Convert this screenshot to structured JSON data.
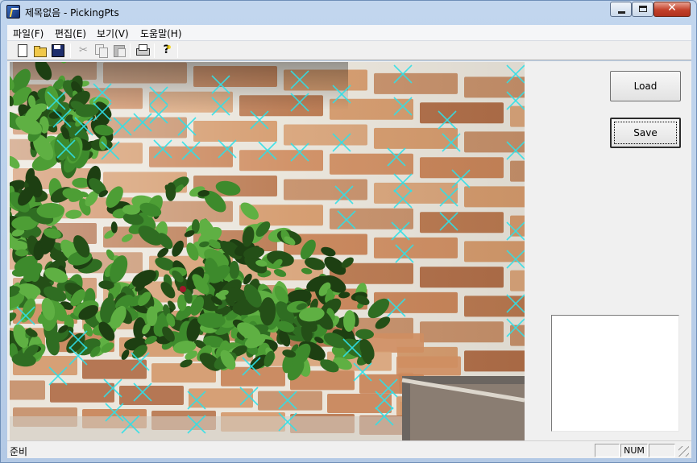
{
  "window": {
    "title": "제목없음 - PickingPts",
    "background_title_ghost": "(offscreen window title blurred)",
    "min_glyph": "",
    "max_glyph": "",
    "close_glyph": "✕"
  },
  "menu": {
    "items": [
      "파일(F)",
      "편집(E)",
      "보기(V)",
      "도움말(H)"
    ]
  },
  "toolbar": {
    "buttons": [
      "new-document-icon",
      "open-folder-icon",
      "save-disk-icon",
      "cut-scissors-icon",
      "copy-icon",
      "paste-icon",
      "print-icon",
      "help-icon"
    ],
    "cut_glyph": "✂",
    "help_glyph": "?"
  },
  "side_panel": {
    "load_label": "Load",
    "save_label": "Save"
  },
  "status": {
    "text": "준비",
    "pane_left": "",
    "pane_num": "NUM",
    "pane_right": ""
  },
  "colors": {
    "marker_color": "#2fe0e8",
    "brick": "#c98a5c",
    "mortar": "#ece8e0",
    "foliage": "#2f6d22"
  }
}
